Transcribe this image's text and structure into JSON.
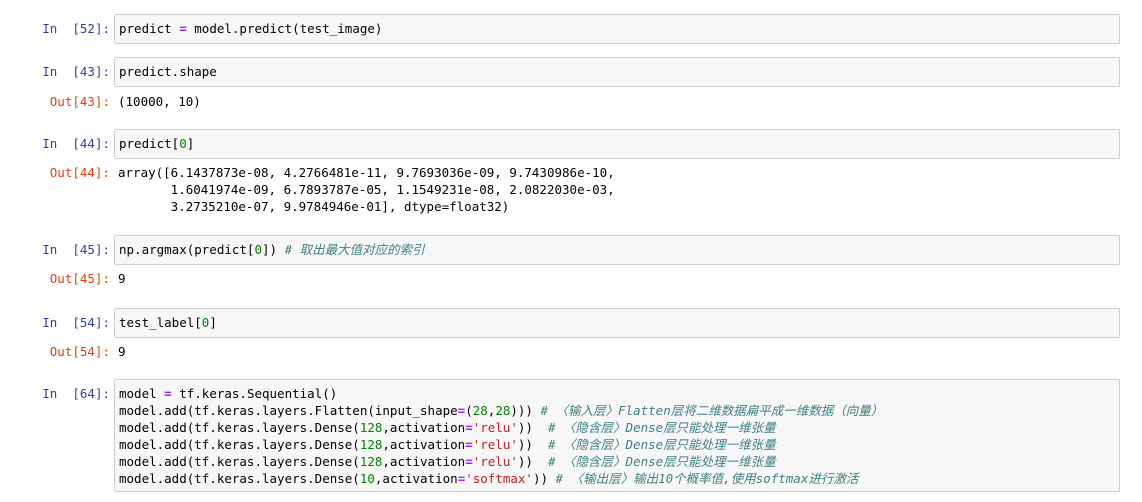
{
  "cells": [
    {
      "in_prompt": "In  [52]:",
      "code": [
        [
          {
            "t": "predict "
          },
          {
            "t": "=",
            "c": "op"
          },
          {
            "t": " model.predict(test_image)"
          }
        ]
      ]
    },
    {
      "in_prompt": "In  [43]:",
      "code": [
        [
          {
            "t": "predict.shape"
          }
        ]
      ],
      "out_prompt": "Out[43]:",
      "output": [
        "(10000, 10)"
      ]
    },
    {
      "in_prompt": "In  [44]:",
      "code": [
        [
          {
            "t": "predict["
          },
          {
            "t": "0",
            "c": "num"
          },
          {
            "t": "]"
          }
        ]
      ],
      "out_prompt": "Out[44]:",
      "output": [
        "array([6.1437873e-08, 4.2766481e-11, 9.7693036e-09, 9.7430986e-10,",
        "       1.6041974e-09, 6.7893787e-05, 1.1549231e-08, 2.0822030e-03,",
        "       3.2735210e-07, 9.9784946e-01], dtype=float32)"
      ]
    },
    {
      "in_prompt": "In  [45]:",
      "code": [
        [
          {
            "t": "np.argmax(predict["
          },
          {
            "t": "0",
            "c": "num"
          },
          {
            "t": "]) "
          },
          {
            "t": "# 取出最大值对应的索引",
            "c": "cm"
          }
        ]
      ],
      "out_prompt": "Out[45]:",
      "output": [
        "9"
      ]
    },
    {
      "in_prompt": "In  [54]:",
      "code": [
        [
          {
            "t": "test_label["
          },
          {
            "t": "0",
            "c": "num"
          },
          {
            "t": "]"
          }
        ]
      ],
      "out_prompt": "Out[54]:",
      "output": [
        "9"
      ]
    },
    {
      "in_prompt": "In  [64]:",
      "code": [
        [
          {
            "t": "model "
          },
          {
            "t": "=",
            "c": "op"
          },
          {
            "t": " tf.keras.Sequential()"
          }
        ],
        [
          {
            "t": "model.add(tf.keras.layers.Flatten(input_shape"
          },
          {
            "t": "=",
            "c": "op"
          },
          {
            "t": "("
          },
          {
            "t": "28",
            "c": "num"
          },
          {
            "t": ","
          },
          {
            "t": "28",
            "c": "num"
          },
          {
            "t": "))) "
          },
          {
            "t": "# 〈输入层〉Flatten层将二维数据扁平成一维数据（向量）",
            "c": "cm"
          }
        ],
        [
          {
            "t": "model.add(tf.keras.layers.Dense("
          },
          {
            "t": "128",
            "c": "num"
          },
          {
            "t": ",activation"
          },
          {
            "t": "=",
            "c": "op"
          },
          {
            "t": "'relu'",
            "c": "str"
          },
          {
            "t": "))  "
          },
          {
            "t": "# 〈隐含层〉Dense层只能处理一维张量",
            "c": "cm"
          }
        ],
        [
          {
            "t": "model.add(tf.keras.layers.Dense("
          },
          {
            "t": "128",
            "c": "num"
          },
          {
            "t": ",activation"
          },
          {
            "t": "=",
            "c": "op"
          },
          {
            "t": "'relu'",
            "c": "str"
          },
          {
            "t": "))  "
          },
          {
            "t": "# 〈隐含层〉Dense层只能处理一维张量",
            "c": "cm"
          }
        ],
        [
          {
            "t": "model.add(tf.keras.layers.Dense("
          },
          {
            "t": "128",
            "c": "num"
          },
          {
            "t": ",activation"
          },
          {
            "t": "=",
            "c": "op"
          },
          {
            "t": "'relu'",
            "c": "str"
          },
          {
            "t": "))  "
          },
          {
            "t": "# 〈隐含层〉Dense层只能处理一维张量",
            "c": "cm"
          }
        ],
        [
          {
            "t": "model.add(tf.keras.layers.Dense("
          },
          {
            "t": "10",
            "c": "num"
          },
          {
            "t": ",activation"
          },
          {
            "t": "=",
            "c": "op"
          },
          {
            "t": "'softmax'",
            "c": "str"
          },
          {
            "t": ")) "
          },
          {
            "t": "# 〈输出层〉输出10个概率值,使用softmax进行激活",
            "c": "cm"
          }
        ]
      ]
    }
  ]
}
